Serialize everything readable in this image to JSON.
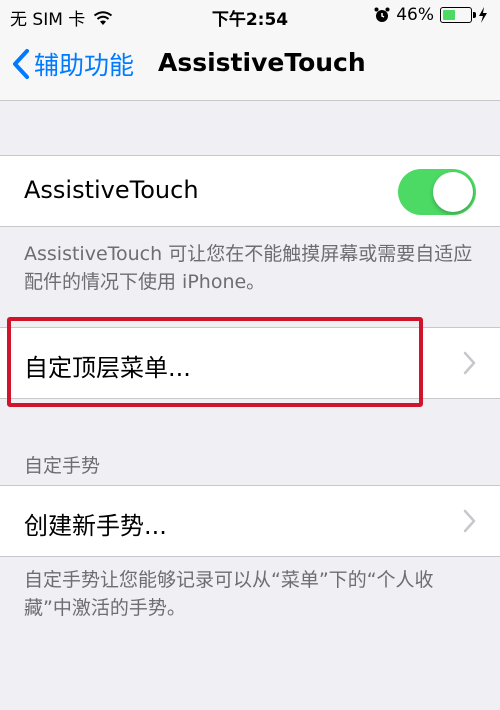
{
  "status_bar": {
    "carrier": "无 SIM 卡",
    "time": "下午2:54",
    "battery_percent": "46%",
    "battery_level": 0.46,
    "icons": [
      "wifi-icon",
      "alarm-icon",
      "battery-icon",
      "charging-icon"
    ]
  },
  "nav": {
    "back_label": "辅助功能",
    "title": "AssistiveTouch"
  },
  "assistive_touch": {
    "label": "AssistiveTouch",
    "enabled": true,
    "description": "AssistiveTouch 可让您在不能触摸屏幕或需要自适应配件的情况下使用 iPhone。"
  },
  "customize_menu": {
    "label": "自定顶层菜单..."
  },
  "custom_gestures": {
    "header": "自定手势",
    "create_label": "创建新手势...",
    "footer": "自定手势让您能够记录可以从“菜单”下的“个人收藏”中激活的手势。"
  },
  "colors": {
    "accent": "#007aff",
    "toggle_on": "#4cd964",
    "highlight": "#d0142c",
    "background": "#efeff4"
  }
}
